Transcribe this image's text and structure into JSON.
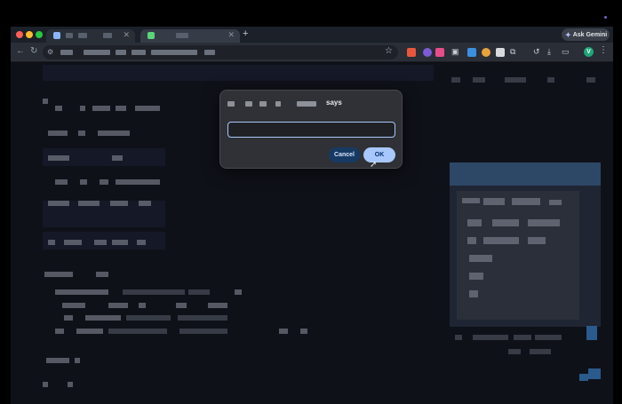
{
  "browser": {
    "tabs": [
      {
        "favicon_color": "#8ab4f8",
        "close_icon": "✕"
      },
      {
        "favicon_color": "#5bd47a",
        "close_icon": "✕"
      }
    ],
    "new_tab_icon": "+",
    "ask_gemini_label": "Ask Gemini",
    "profile_initial": "V",
    "nav": {
      "back": "←",
      "reload": "↻"
    },
    "bookmark_icon": "☆",
    "menu_icon": "⋮"
  },
  "dialog": {
    "says_label": "says",
    "input_value": "",
    "cancel_label": "Cancel",
    "ok_label": "OK"
  },
  "colors": {
    "dialog_bg": "#2f3136",
    "ok_button": "#a8c7fa",
    "cancel_button": "#163a63",
    "page_bg": "#0f1119",
    "panel_header": "#2d4766"
  }
}
